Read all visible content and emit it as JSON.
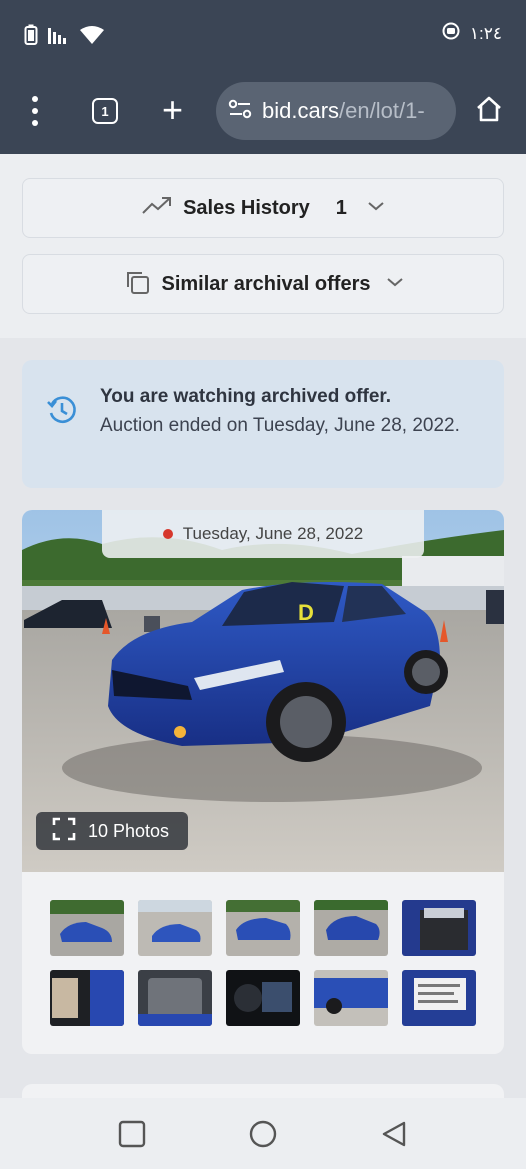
{
  "status_bar": {
    "time": "١:٢٤",
    "icons": [
      "battery-icon",
      "signal-icon",
      "wifi-icon",
      "data-saver-icon"
    ]
  },
  "browser": {
    "tab_count": "1",
    "url_host": "bid.cars",
    "url_path": "/en/lot/1-",
    "icons": [
      "menu-icon",
      "tabs-icon",
      "new-tab-icon",
      "site-settings-icon",
      "home-icon"
    ]
  },
  "sections": {
    "sales_history": {
      "label": "Sales History",
      "count": "1"
    },
    "similar_offers": {
      "label": "Similar archival offers"
    }
  },
  "notice": {
    "title": "You are watching archived offer.",
    "body": "Auction ended on Tuesday, June 28, 2022."
  },
  "lot": {
    "auction_date": "Tuesday, June 28, 2022",
    "photos_label": "10 Photos",
    "windshield_mark": "D",
    "thumbnail_count": 10
  },
  "nav": {
    "icons": [
      "recents-icon",
      "home-circle-icon",
      "back-icon"
    ]
  },
  "colors": {
    "header": "#3b4555",
    "accent_blue": "#3a8fd6",
    "car_blue": "#1f3f9e",
    "status_dot": "#d6372c"
  }
}
